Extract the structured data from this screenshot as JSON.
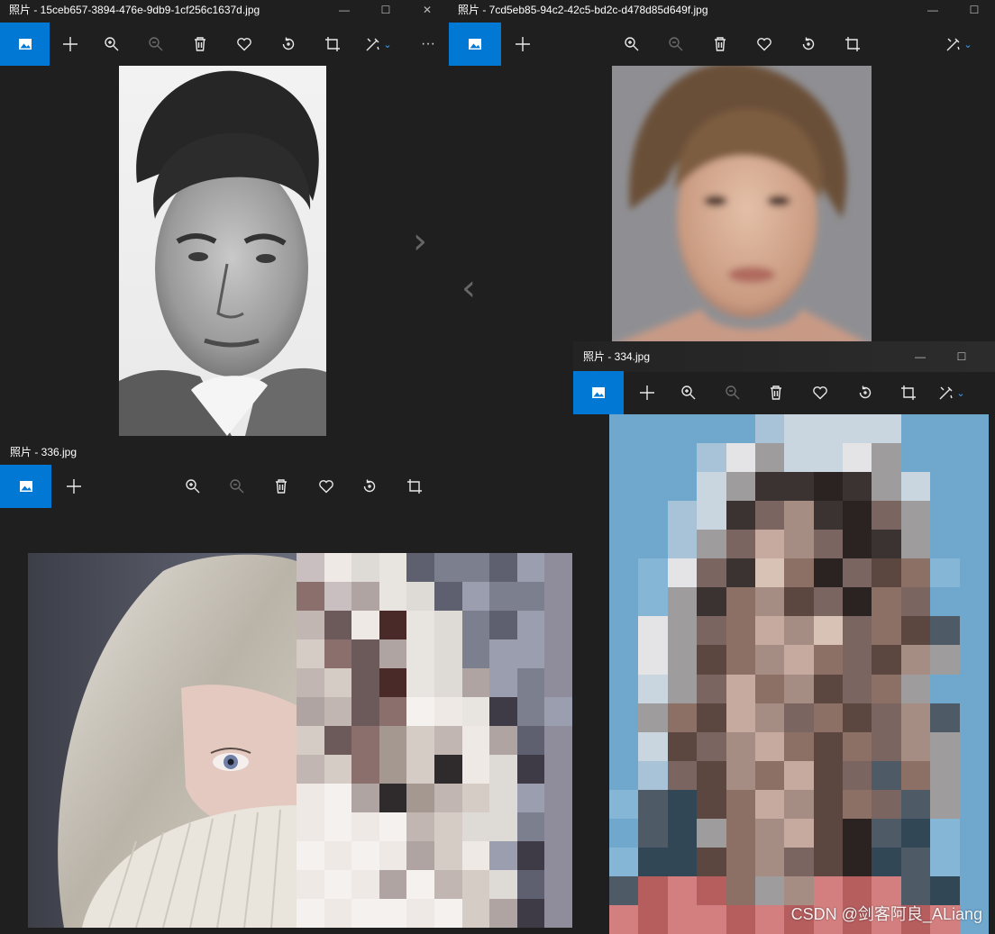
{
  "windows": {
    "w1": {
      "title": "照片 - 15ceb657-3894-476e-9db9-1cf256c1637d.jpg",
      "min": "—",
      "max": "☐",
      "close": "✕",
      "more": "···"
    },
    "w2": {
      "title": "照片 - 7cd5eb85-94c2-42c5-bd2c-d478d85d649f.jpg",
      "min": "—",
      "max": "☐"
    },
    "w3": {
      "title": "照片 - 334.jpg",
      "min": "—",
      "max": "☐"
    },
    "w4": {
      "title": "照片 - 336.jpg"
    }
  },
  "toolbar_icons": [
    "view-photo-icon",
    "add-icon",
    "zoom-in-icon",
    "zoom-out-icon",
    "delete-icon",
    "favorite-icon",
    "rotate-icon",
    "crop-icon",
    "edit-icon"
  ],
  "nav": {
    "next": "›",
    "prev": "‹"
  },
  "watermark": "CSDN @剑客阿良_ALiang",
  "colors": {
    "accent": "#0078d4",
    "background": "#1f1f1f"
  }
}
